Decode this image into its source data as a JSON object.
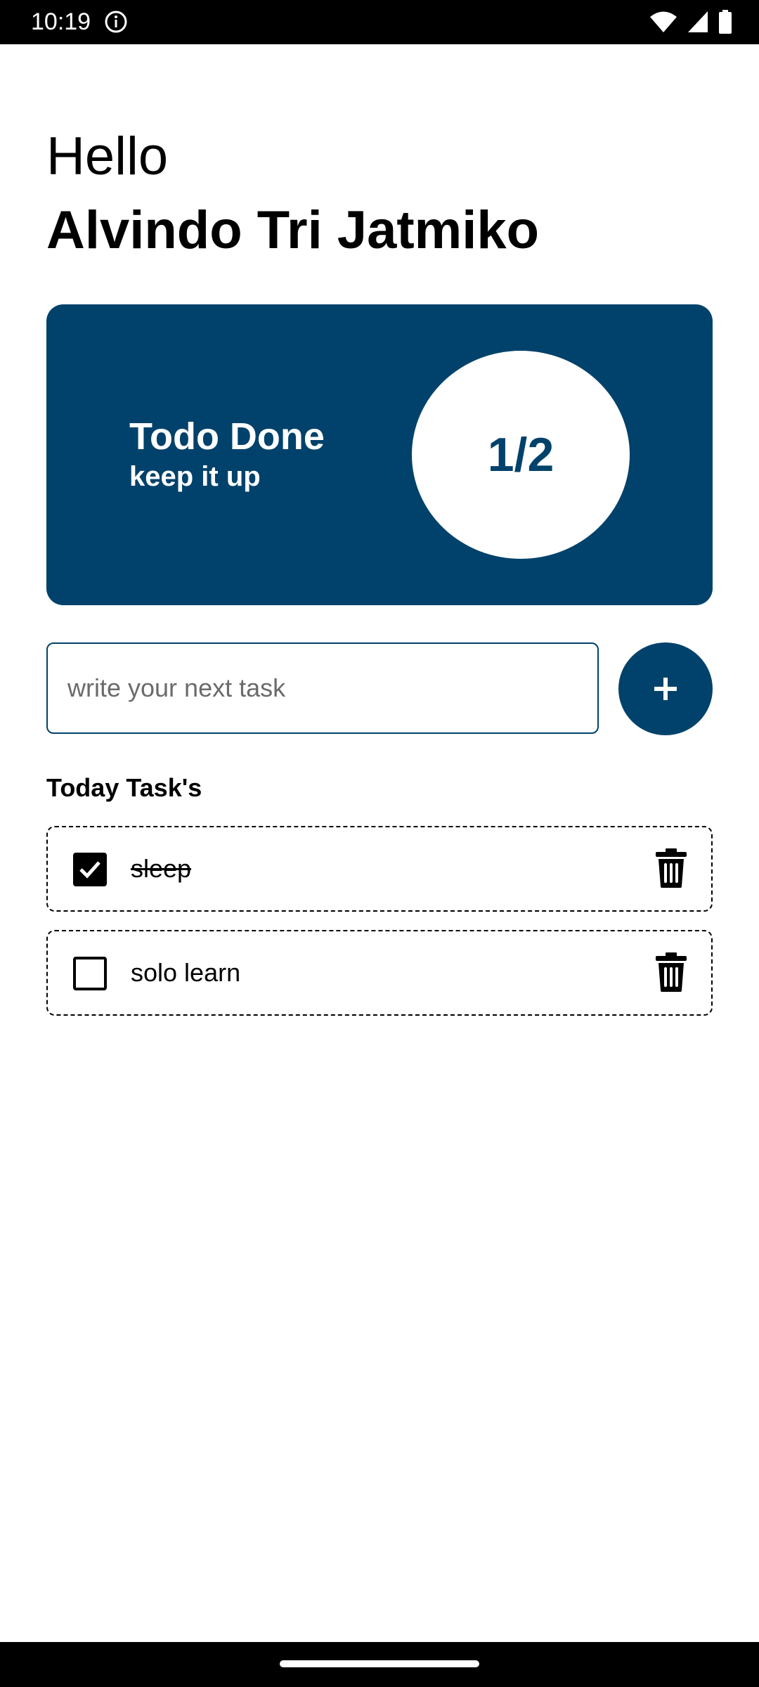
{
  "status_bar": {
    "time": "10:19"
  },
  "greeting": {
    "hello": "Hello",
    "name": "Alvindo Tri Jatmiko"
  },
  "progress_card": {
    "title": "Todo Done",
    "subtitle": "keep it up",
    "count": "1/2",
    "done": 1,
    "total": 2
  },
  "new_task": {
    "placeholder": "write your next task",
    "value": ""
  },
  "section": {
    "title": "Today Task's"
  },
  "tasks": [
    {
      "label": "sleep",
      "done": true
    },
    {
      "label": "solo learn",
      "done": false
    }
  ],
  "colors": {
    "primary": "#00426b",
    "background": "#ffffff",
    "text": "#000000"
  },
  "icons": {
    "add": "plus-icon",
    "delete": "trash-icon",
    "check": "check-icon"
  }
}
